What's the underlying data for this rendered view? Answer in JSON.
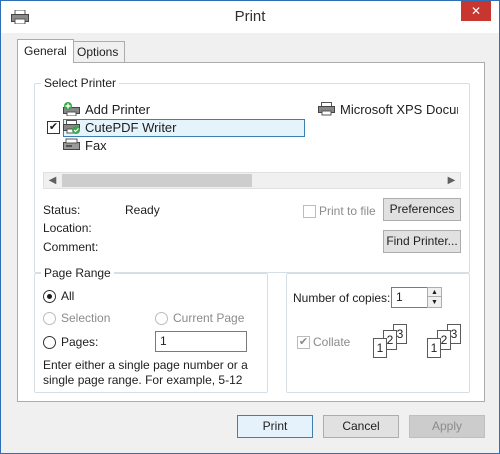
{
  "window": {
    "title": "Print",
    "close_symbol": "✕"
  },
  "tabs": [
    {
      "label": "General",
      "active": true
    },
    {
      "label": "Options",
      "active": false
    }
  ],
  "select_printer": {
    "group_label": "Select Printer",
    "printers": [
      {
        "name": "Add Printer",
        "icon": "add-printer-icon"
      },
      {
        "name": "CutePDF Writer",
        "icon": "printer-default-icon",
        "selected": true,
        "checked": true
      },
      {
        "name": "Fax",
        "icon": "fax-icon"
      },
      {
        "name": "Microsoft XPS Docum",
        "icon": "printer-icon"
      }
    ],
    "status_label": "Status:",
    "status_value": "Ready",
    "location_label": "Location:",
    "comment_label": "Comment:",
    "print_to_file_label": "Print to file",
    "preferences_label": "Preferences",
    "find_printer_label": "Find Printer..."
  },
  "page_range": {
    "group_label": "Page Range",
    "all_label": "All",
    "selection_label": "Selection",
    "current_page_label": "Current Page",
    "pages_label": "Pages:",
    "pages_value": "1",
    "hint": "Enter either a single page number or a single page range.  For example, 5-12"
  },
  "copies": {
    "label": "Number of copies:",
    "value": "1",
    "collate_label": "Collate",
    "collate_checked": true,
    "page_numbers": [
      "1",
      "2",
      "3"
    ]
  },
  "footer": {
    "print_label": "Print",
    "cancel_label": "Cancel",
    "apply_label": "Apply"
  },
  "colors": {
    "accent": "#3c7fb1",
    "close_red": "#c7372f",
    "window_border": "#2f6fb5"
  }
}
